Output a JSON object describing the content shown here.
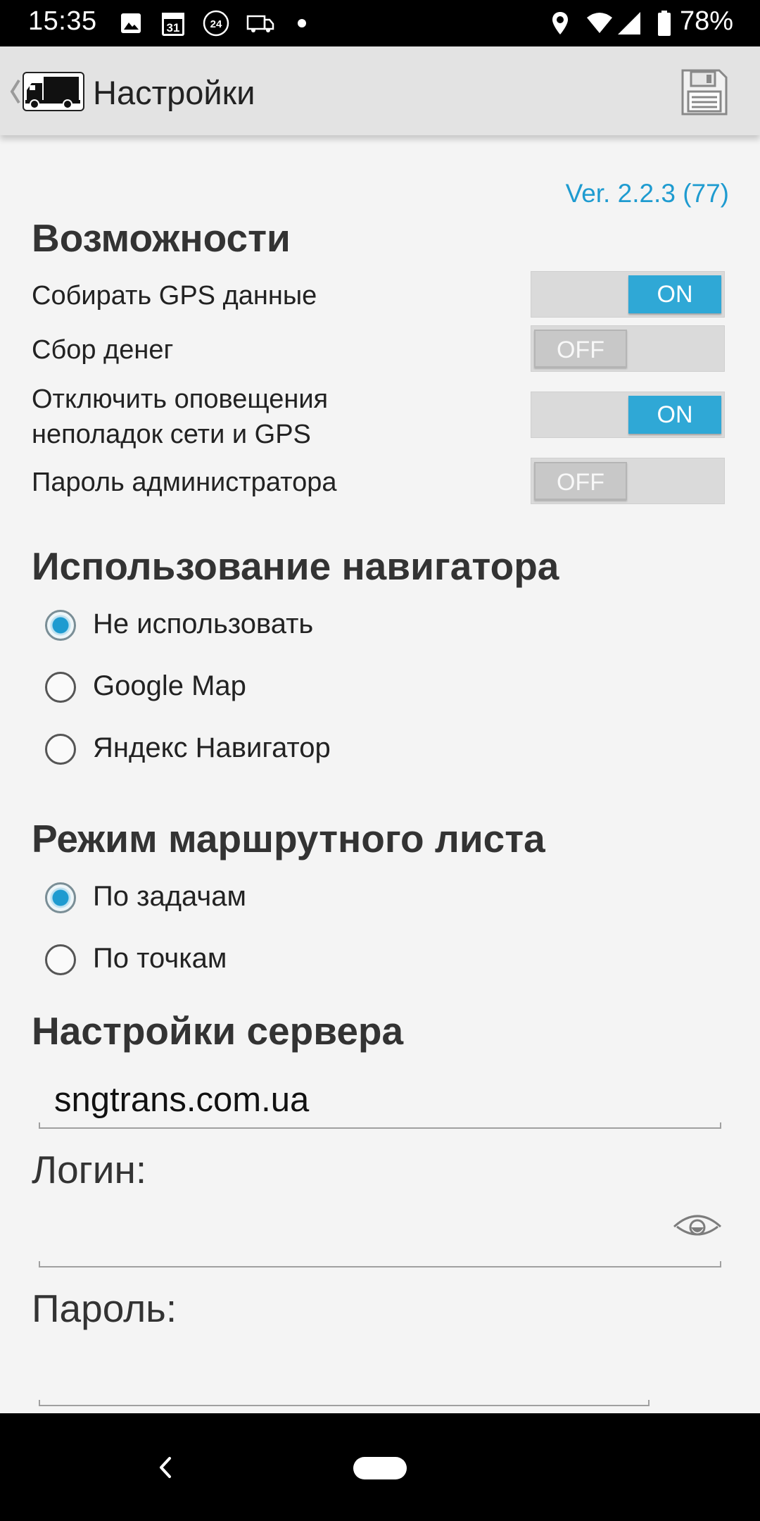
{
  "status_bar": {
    "time": "15:35",
    "calendar_day": "31",
    "badge_24": "24",
    "battery_percent": "78%",
    "icons": [
      "gallery-icon",
      "calendar-icon",
      "24-clock-icon",
      "truck-icon",
      "dot-icon",
      "location-icon",
      "wifi-icon",
      "signal-icon",
      "battery-icon"
    ]
  },
  "action_bar": {
    "title": "Настройки",
    "icons": [
      "back-chevron-icon",
      "truck-logo-icon",
      "save-icon"
    ]
  },
  "version": "Ver. 2.2.3 (77)",
  "features": {
    "title": "Возможности",
    "items": [
      {
        "label": "Собирать GPS данные",
        "state": "ON"
      },
      {
        "label": "Сбор денег",
        "state": "OFF"
      },
      {
        "label_line1": "Отключить оповещения",
        "label_line2": "неполадок сети и GPS",
        "state": "ON"
      },
      {
        "label": "Пароль администратора",
        "state": "OFF"
      }
    ]
  },
  "navigator": {
    "title": "Использование навигатора",
    "options": [
      {
        "label": "Не использовать",
        "checked": true
      },
      {
        "label": "Google Map",
        "checked": false
      },
      {
        "label": "Яндекс Навигатор",
        "checked": false
      }
    ]
  },
  "route_mode": {
    "title": "Режим маршрутного листа",
    "options": [
      {
        "label": "По задачам",
        "checked": true
      },
      {
        "label": "По точкам",
        "checked": false
      }
    ]
  },
  "server": {
    "title": "Настройки сервера",
    "address": "sngtrans.com.ua",
    "login_label": "Логин:",
    "login_value": "",
    "password_label": "Пароль:",
    "password_value": ""
  },
  "colors": {
    "accent": "#2fa8d6",
    "version_text": "#1e9bd0",
    "background": "#f4f4f4",
    "action_bar": "#e3e3e3"
  }
}
